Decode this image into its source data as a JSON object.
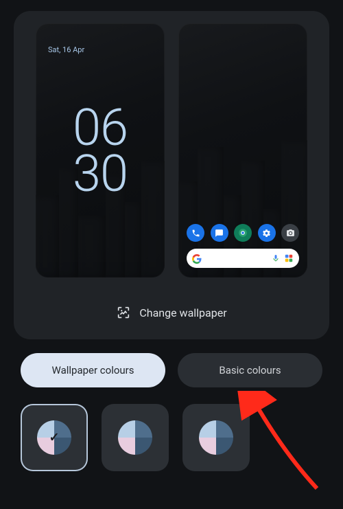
{
  "preview": {
    "lock_date": "Sat, 16 Apr",
    "lock_time_top": "06",
    "lock_time_bottom": "30",
    "change_wallpaper_label": "Change wallpaper"
  },
  "dock_icons": [
    {
      "name": "phone",
      "bg": "#1a73e8",
      "glyph": "📞"
    },
    {
      "name": "messages",
      "bg": "#1a73e8",
      "glyph": "💬"
    },
    {
      "name": "browser",
      "bg": "#0b7d57",
      "glyph": "🌐"
    },
    {
      "name": "settings",
      "bg": "#1a73e8",
      "glyph": "⚙"
    },
    {
      "name": "camera",
      "bg": "#2d3136",
      "glyph": "📷"
    }
  ],
  "tabs": {
    "wallpaper_colours": "Wallpaper colours",
    "basic_colours": "Basic colours",
    "active": "wallpaper_colours"
  },
  "swatches": [
    {
      "selected": true,
      "colors": [
        "#b7cfe6",
        "#4f6e8c",
        "#e8cddf",
        "#3b5772"
      ]
    },
    {
      "selected": false,
      "colors": [
        "#b7cfe6",
        "#4f6e8c",
        "#e8cddf",
        "#3b5772"
      ]
    },
    {
      "selected": false,
      "colors": [
        "#b7cfe6",
        "#4f6e8c",
        "#e8cddf",
        "#3b5772"
      ]
    }
  ]
}
